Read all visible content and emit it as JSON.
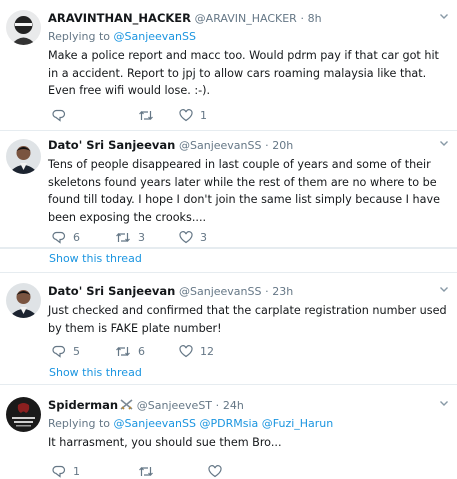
{
  "tweets": [
    {
      "name": "ARAVINTHAN_HACKER",
      "handle": "@ARAVIN_HACKER",
      "dot": "·",
      "time": "8h",
      "replying_prefix": "Replying to",
      "replying_to": "@SanjeevanSS",
      "text": "Make a police report and macc too. Would pdrm pay if that car got hit in a accident. Report to jpj to allow cars roaming malaysia like that. Even free wifi would lose. :-).",
      "replies": "",
      "retweets": "",
      "likes": "1",
      "show_thread": ""
    },
    {
      "name": "Dato' Sri Sanjeevan",
      "handle": "@SanjeevanSS",
      "dot": "·",
      "time": "20h",
      "replying_prefix": "",
      "replying_to": "",
      "text": "Tens of people disappeared in last couple of years and some of their skeletons found years later while the rest of them are no where to be found till today. I hope I don't join the same list simply because I have been exposing the crooks....",
      "replies": "6",
      "retweets": "3",
      "likes": "3",
      "show_thread": "Show this thread"
    },
    {
      "name": "Dato' Sri Sanjeevan",
      "handle": "@SanjeevanSS",
      "dot": "·",
      "time": "23h",
      "replying_prefix": "",
      "replying_to": "",
      "text": "Just checked and confirmed that the carplate registration number used by them is FAKE plate number!",
      "replies": "5",
      "retweets": "6",
      "likes": "12",
      "show_thread": "Show this thread"
    },
    {
      "name": "Spiderman",
      "handle": "@SanjeeveST",
      "dot": "·",
      "time": "24h",
      "replying_prefix": "Replying to",
      "replying_to": "@SanjeevanSS @PDRMsia @Fuzi_Harun",
      "text": "It harrasment, you should sue them Bro...",
      "replies": "1",
      "retweets": "",
      "likes": "",
      "show_thread": ""
    }
  ],
  "icons": {
    "reply": "reply-icon",
    "retweet": "retweet-icon",
    "like": "heart-icon",
    "menu": "chevron-down-icon",
    "badge": "crossed-swords-icon"
  },
  "colors": {
    "link": "#1b95e0",
    "muted": "#657786",
    "divider": "#e6ecf0",
    "text": "#14171a"
  }
}
